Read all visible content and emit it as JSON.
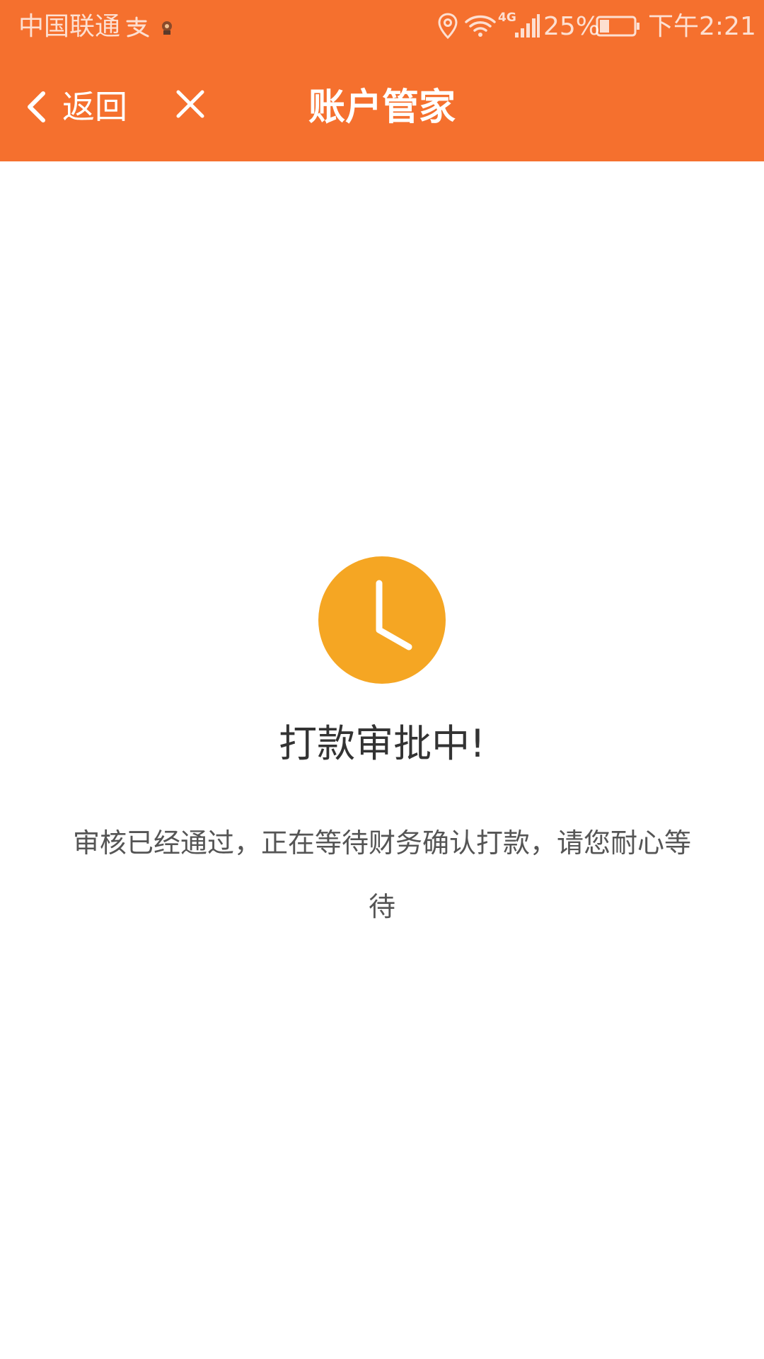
{
  "status_bar": {
    "carrier": "中国联通",
    "battery_percent": "25%",
    "time": "下午2:21",
    "network_label": "4G",
    "icons": [
      "alipay-icon",
      "app-notification-icon",
      "location-icon",
      "wifi-icon",
      "signal-icon",
      "battery-icon"
    ]
  },
  "nav": {
    "back_label": "返回",
    "title": "账户管家",
    "back_icon": "chevron-left-icon",
    "close_icon": "close-icon"
  },
  "content": {
    "title": "打款审批中!",
    "description": "审核已经通过，正在等待财务确认打款，请您耐心等待",
    "icon": "clock-icon"
  },
  "colors": {
    "brand": "#F5702E",
    "clock": "#F5A623",
    "text_primary": "#333333",
    "text_secondary": "#555555"
  }
}
